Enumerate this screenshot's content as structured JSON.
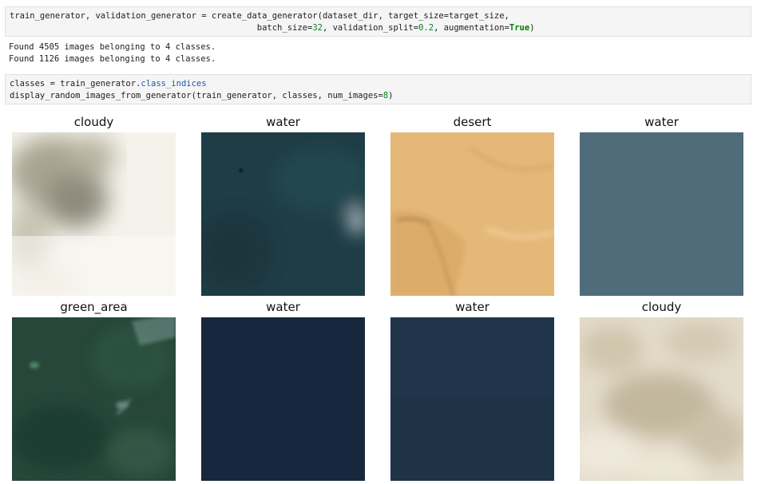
{
  "notebook": {
    "cell1": {
      "line1": {
        "vars": "train_generator, validation_generator ",
        "eq": "=",
        "call": " create_data_generator(dataset_dir, target_size",
        "eq2": "=",
        "rest": "target_size,"
      },
      "line2": {
        "indent": "                                                 ",
        "p1": "batch_size",
        "eq": "=",
        "n1": "32",
        "p2": ", validation_split",
        "eq2": "=",
        "n2": "0.2",
        "p3": ", augmentation",
        "eq3": "=",
        "kw": "True",
        "close": ")"
      }
    },
    "output": {
      "line1": "Found 4505 images belonging to 4 classes.",
      "line2": "Found 1126 images belonging to 4 classes."
    },
    "cell2": {
      "line1": {
        "a": "classes ",
        "eq": "=",
        "b": " train_generator.",
        "attr": "class_indices"
      },
      "line2": {
        "a": "display_random_images_from_generator(train_generator, classes, num_images",
        "eq": "=",
        "n": "8",
        "close": ")"
      }
    }
  },
  "images": [
    {
      "label": "cloudy",
      "kind": "cloudy-bright"
    },
    {
      "label": "water",
      "kind": "water-teal"
    },
    {
      "label": "desert",
      "kind": "desert"
    },
    {
      "label": "water",
      "kind": "water-slate"
    },
    {
      "label": "green_area",
      "kind": "green"
    },
    {
      "label": "water",
      "kind": "water-navy"
    },
    {
      "label": "water",
      "kind": "water-deep"
    },
    {
      "label": "cloudy",
      "kind": "cloudy-beige"
    }
  ],
  "colors": {
    "cell_bg": "#f5f5f5",
    "cell_border": "#e0e0e0",
    "number": "#00881a",
    "keyword": "#008000",
    "attribute": "#1e5aa8"
  }
}
